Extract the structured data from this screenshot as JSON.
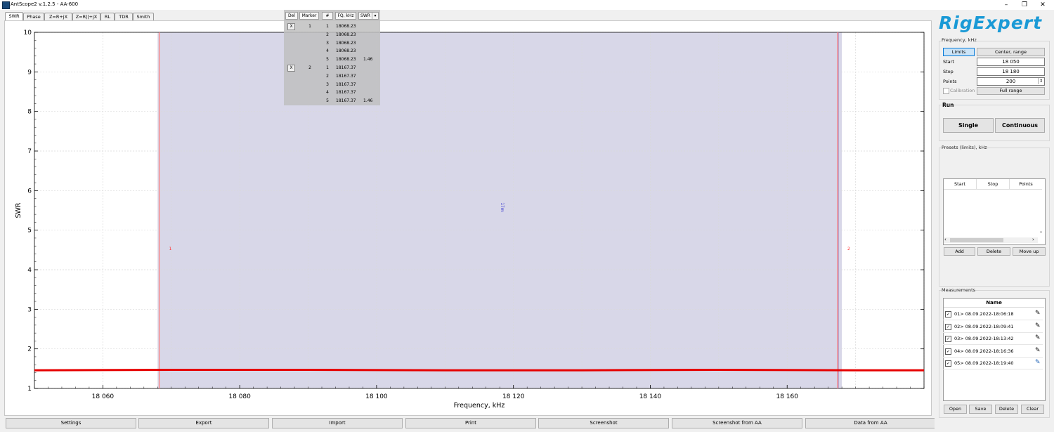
{
  "window": {
    "title": "AntScope2 v.1.2.5 - AA-600",
    "minimize": "–",
    "restore": "❐",
    "close": "✕"
  },
  "tabs": [
    "SWR",
    "Phase",
    "Z=R+jX",
    "Z=R||+jX",
    "RL",
    "TDR",
    "Smith"
  ],
  "marker_table": {
    "headers": [
      "Del",
      "Marker",
      "#",
      "FQ, kHz",
      "SWR"
    ],
    "dropdown_glyph": "▾",
    "rows": [
      {
        "del": "X",
        "marker": "1",
        "num": "1",
        "fq": "18068.23",
        "swr": ""
      },
      {
        "del": "",
        "marker": "",
        "num": "2",
        "fq": "18068.23",
        "swr": ""
      },
      {
        "del": "",
        "marker": "",
        "num": "3",
        "fq": "18068.23",
        "swr": ""
      },
      {
        "del": "",
        "marker": "",
        "num": "4",
        "fq": "18068.23",
        "swr": ""
      },
      {
        "del": "",
        "marker": "",
        "num": "5",
        "fq": "18068.23",
        "swr": "1.46"
      },
      {
        "del": "X",
        "marker": "2",
        "num": "1",
        "fq": "18167.37",
        "swr": ""
      },
      {
        "del": "",
        "marker": "",
        "num": "2",
        "fq": "18167.37",
        "swr": ""
      },
      {
        "del": "",
        "marker": "",
        "num": "3",
        "fq": "18167.37",
        "swr": ""
      },
      {
        "del": "",
        "marker": "",
        "num": "4",
        "fq": "18167.37",
        "swr": ""
      },
      {
        "del": "",
        "marker": "",
        "num": "5",
        "fq": "18167.37",
        "swr": "1.46"
      }
    ]
  },
  "chart_data": {
    "type": "line",
    "xlabel": "Frequency, kHz",
    "ylabel": "SWR",
    "xlim": [
      18050,
      18180
    ],
    "ylim": [
      1,
      10
    ],
    "x_ticks": [
      {
        "v": 18060,
        "label": "18 060"
      },
      {
        "v": 18080,
        "label": "18 080"
      },
      {
        "v": 18100,
        "label": "18 100"
      },
      {
        "v": 18120,
        "label": "18 120"
      },
      {
        "v": 18140,
        "label": "18 140"
      },
      {
        "v": 18160,
        "label": "18 160"
      }
    ],
    "y_ticks": [
      1,
      2,
      3,
      4,
      5,
      6,
      7,
      8,
      9,
      10
    ],
    "grid": true,
    "band": {
      "x0": 18068,
      "x1": 18168,
      "label": "17m",
      "color": "#d8d7e8"
    },
    "markers": [
      {
        "label": "1",
        "x": 18068.23
      },
      {
        "label": "2",
        "x": 18167.37
      }
    ],
    "series": [
      {
        "color": "#e60000",
        "x": [
          18050,
          18070,
          18090,
          18110,
          18130,
          18150,
          18170,
          18180
        ],
        "y": [
          1.46,
          1.47,
          1.47,
          1.46,
          1.46,
          1.47,
          1.46,
          1.46
        ]
      }
    ]
  },
  "bottom_buttons": [
    "Settings",
    "Export",
    "Import",
    "Print",
    "Screenshot",
    "Screenshot from AA",
    "Data from AA"
  ],
  "right": {
    "logo": "RigExpert",
    "freq_group": "Frequency, kHz",
    "limits": "Limits",
    "center_range": "Center, range",
    "start_label": "Start",
    "start_value": "18 050",
    "stop_label": "Stop",
    "stop_value": "18 180",
    "points_label": "Points",
    "points_value": "200",
    "calibration": "Calibration",
    "full_range": "Full range",
    "run_label": "Run",
    "single": "Single",
    "continuous": "Continuous",
    "presets_label": "Presets (limits), kHz",
    "presets_cols": [
      "Start",
      "Stop",
      "Points"
    ],
    "add": "Add",
    "delete": "Delete",
    "move_up": "Move up",
    "measurements_label": "Measurements",
    "name_col": "Name",
    "measurements": [
      "01> 08.09.2022-18:06:18",
      "02> 08.09.2022-18:09:41",
      "03> 08.09.2022-18:13:42",
      "04> 08.09.2022-18:16:36",
      "05> 08.09.2022-18:19:40"
    ],
    "open": "Open",
    "save": "Save",
    "delete_meas": "Delete",
    "clear": "Clear"
  }
}
